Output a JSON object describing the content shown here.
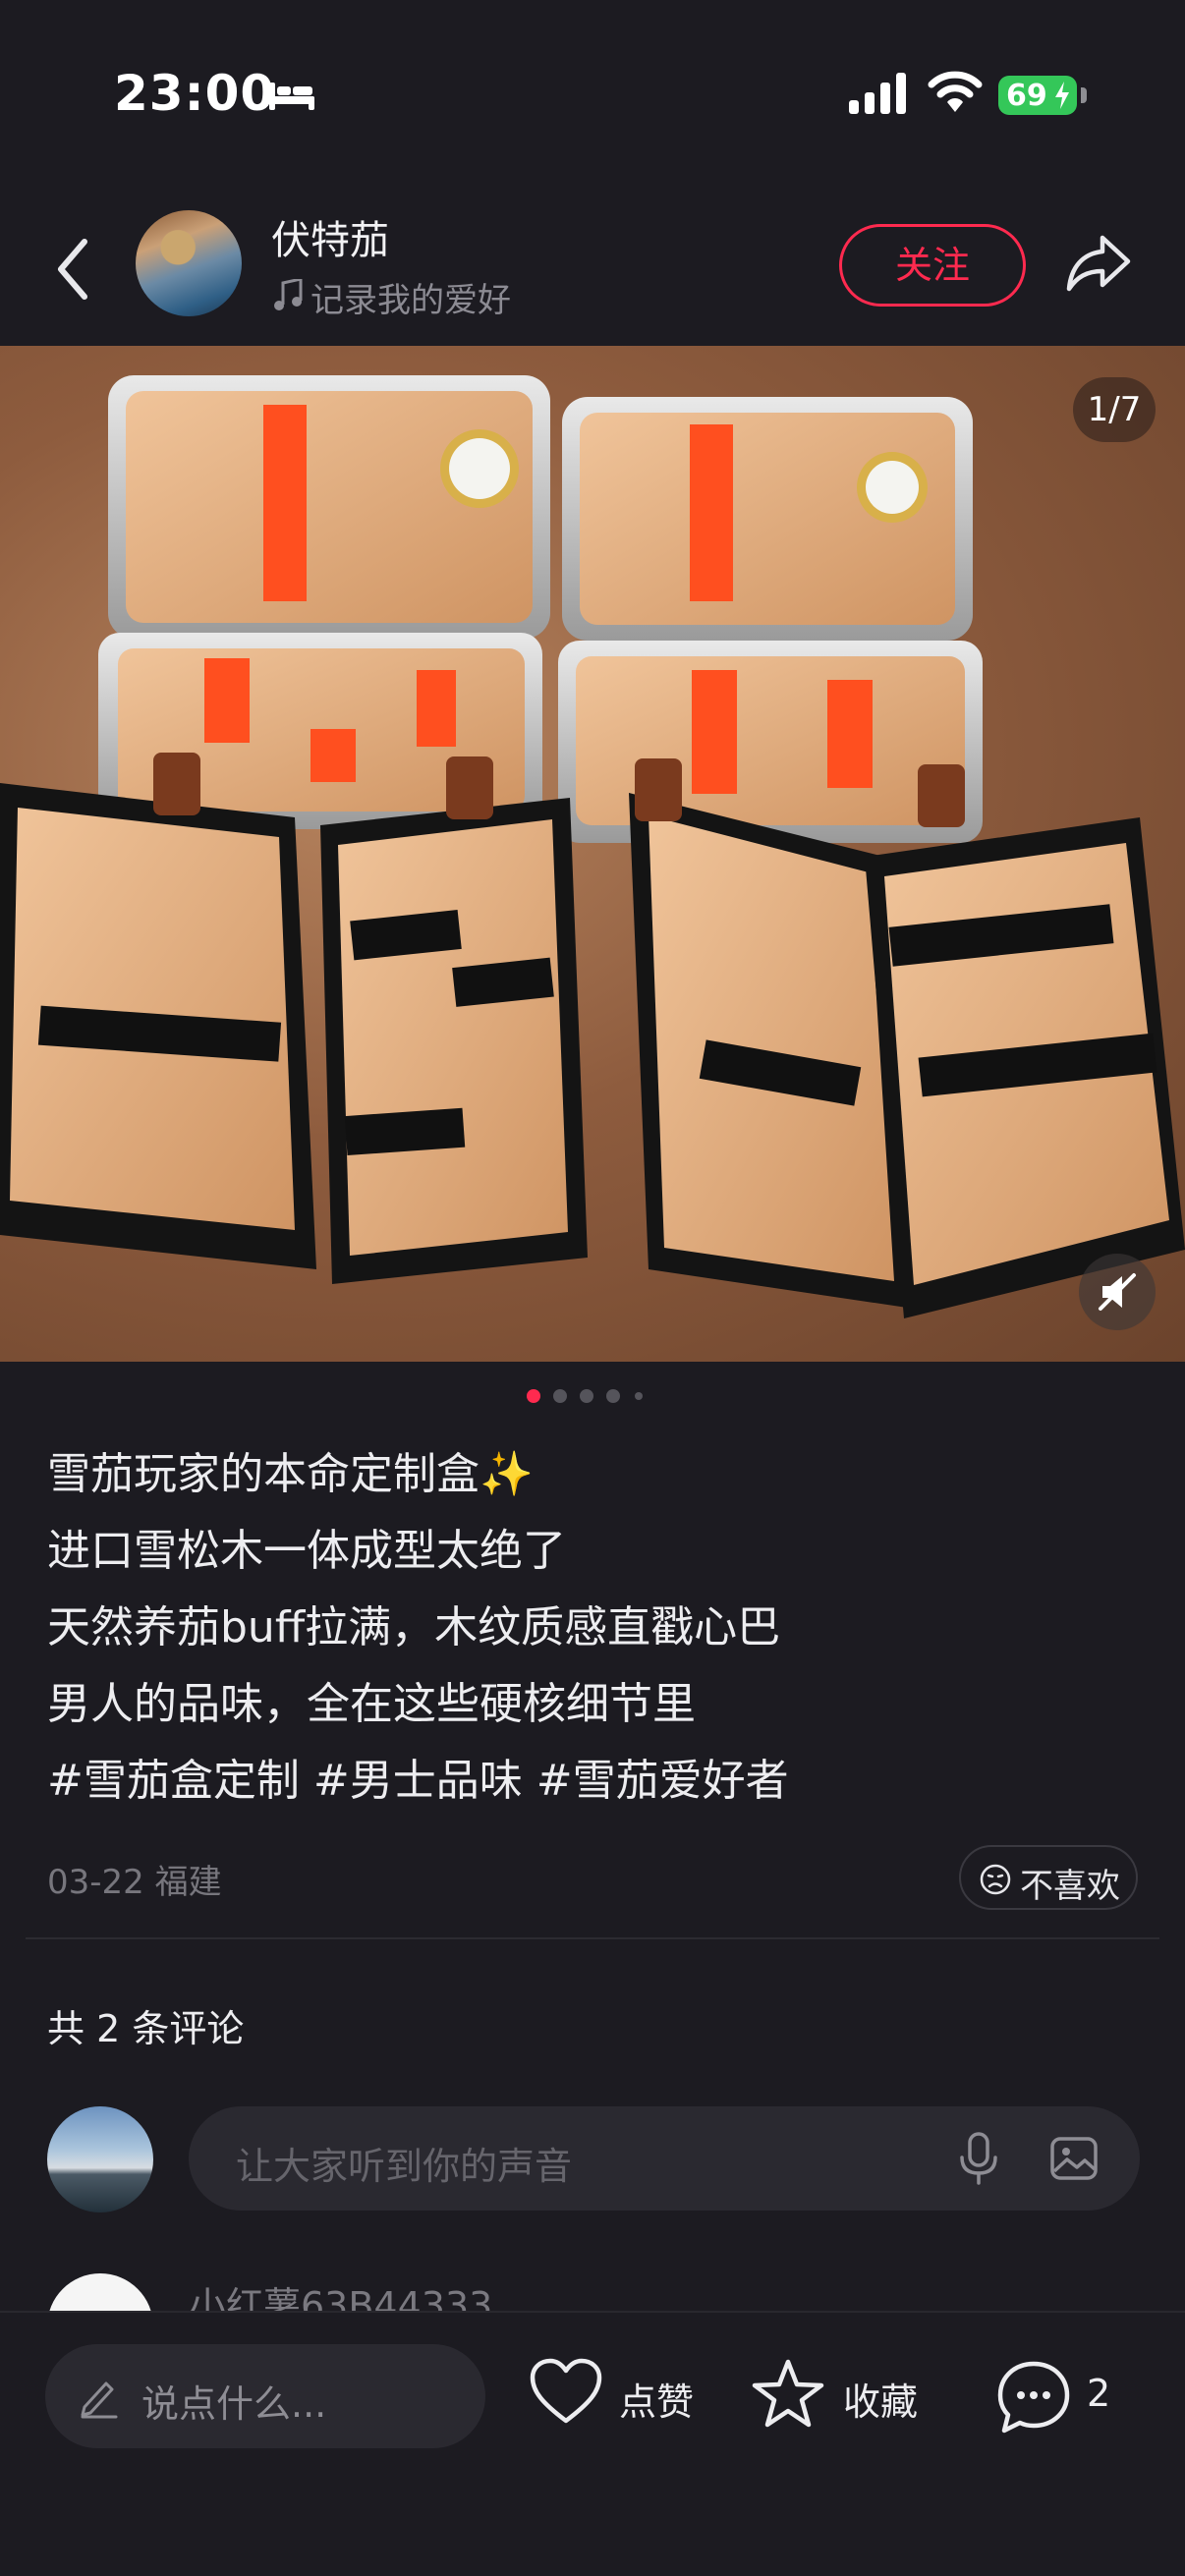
{
  "status_bar": {
    "time": "23:00",
    "battery": "69"
  },
  "header": {
    "author_name": "伏特茄",
    "author_signature": "记录我的爱好",
    "follow_label": "关注"
  },
  "carousel": {
    "page_counter": "1/7",
    "current_index": 1,
    "total_images": 7
  },
  "caption": {
    "lines": [
      "雪茄玩家的本命定制盒✨",
      "进口雪松木一体成型太绝了",
      "天然养茄buff拉满，木纹质感直戳心巴",
      "男人的品味，全在这些硬核细节里"
    ],
    "hashtags": [
      "#雪茄盒定制",
      "#男士品味",
      "#雪茄爱好者"
    ]
  },
  "meta": {
    "date_location": "03-22 福建",
    "dislike_label": "不喜欢"
  },
  "comments": {
    "count_label": "共 2 条评论",
    "input_placeholder": "让大家听到你的声音",
    "first_commenter_name": "小红薯63B44333"
  },
  "bottom_bar": {
    "say_placeholder": "说点什么...",
    "like_label": "点赞",
    "collect_label": "收藏",
    "comment_count": "2"
  },
  "colors": {
    "background": "#1c1b21",
    "accent": "#ff2a4f",
    "battery": "#34c759"
  },
  "icons": [
    "sleep-icon",
    "signal-icon",
    "wifi-icon",
    "back-icon",
    "music-icon",
    "share-icon",
    "mute-icon",
    "dislike-icon",
    "mic-icon",
    "image-icon",
    "pencil-icon",
    "heart-icon",
    "star-icon",
    "comment-icon"
  ]
}
